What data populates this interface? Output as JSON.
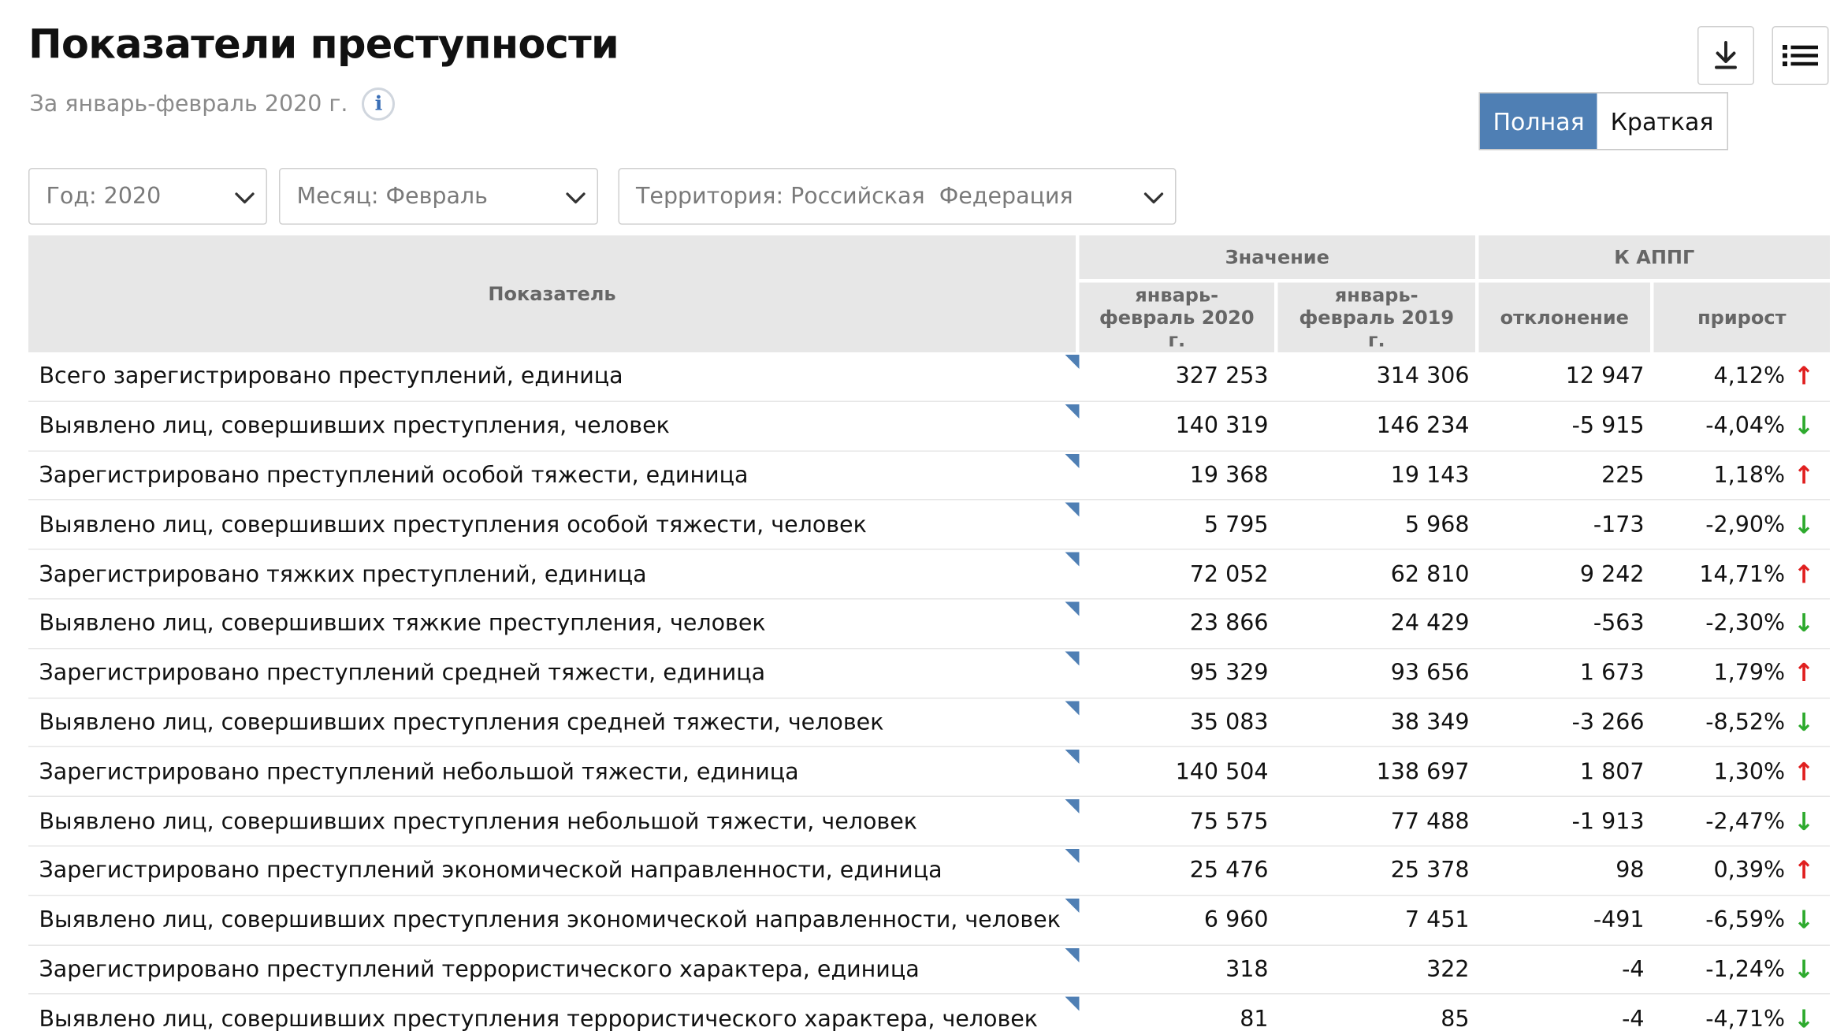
{
  "header": {
    "title": "Показатели преступности",
    "subtitle": "За январь-февраль 2020 г.",
    "info_icon": "info-icon"
  },
  "toolbar": {
    "download_icon": "download-icon",
    "menu_icon": "list-menu-icon"
  },
  "view_toggle": {
    "full_label": "Полная",
    "short_label": "Краткая",
    "active": "full"
  },
  "filters": {
    "year": "Год: 2020",
    "month": "Месяц: Февраль",
    "territory": "Территория: Российская  Федерация"
  },
  "table": {
    "col_indicator": "Показатель",
    "group_value": "Значение",
    "group_appg": "К АППГ",
    "col_2020": "январь-февраль 2020 г.",
    "col_2019": "январь-февраль 2019 г.",
    "col_deviation": "отклонение",
    "col_growth": "прирост",
    "accent_up": "#e02020",
    "accent_down": "#2eaa2e",
    "rows": [
      {
        "name": "Всего зарегистрировано преступлений, единица",
        "v2020": "327 253",
        "v2019": "314 306",
        "dev": "12 947",
        "growth": "4,12%",
        "dir": "up"
      },
      {
        "name": "Выявлено лиц, совершивших преступления, человек",
        "v2020": "140 319",
        "v2019": "146 234",
        "dev": "-5 915",
        "growth": "-4,04%",
        "dir": "down"
      },
      {
        "name": "Зарегистрировано преступлений особой тяжести, единица",
        "v2020": "19 368",
        "v2019": "19 143",
        "dev": "225",
        "growth": "1,18%",
        "dir": "up"
      },
      {
        "name": "Выявлено лиц, совершивших преступления особой тяжести, человек",
        "v2020": "5 795",
        "v2019": "5 968",
        "dev": "-173",
        "growth": "-2,90%",
        "dir": "down"
      },
      {
        "name": "Зарегистрировано тяжких преступлений, единица",
        "v2020": "72 052",
        "v2019": "62 810",
        "dev": "9 242",
        "growth": "14,71%",
        "dir": "up"
      },
      {
        "name": "Выявлено лиц, совершивших тяжкие преступления, человек",
        "v2020": "23 866",
        "v2019": "24 429",
        "dev": "-563",
        "growth": "-2,30%",
        "dir": "down"
      },
      {
        "name": "Зарегистрировано преступлений средней тяжести, единица",
        "v2020": "95 329",
        "v2019": "93 656",
        "dev": "1 673",
        "growth": "1,79%",
        "dir": "up"
      },
      {
        "name": "Выявлено лиц, совершивших преступления средней тяжести, человек",
        "v2020": "35 083",
        "v2019": "38 349",
        "dev": "-3 266",
        "growth": "-8,52%",
        "dir": "down"
      },
      {
        "name": "Зарегистрировано преступлений небольшой тяжести, единица",
        "v2020": "140 504",
        "v2019": "138 697",
        "dev": "1 807",
        "growth": "1,30%",
        "dir": "up"
      },
      {
        "name": "Выявлено лиц, совершивших преступления небольшой тяжести, человек",
        "v2020": "75 575",
        "v2019": "77 488",
        "dev": "-1 913",
        "growth": "-2,47%",
        "dir": "down"
      },
      {
        "name": "Зарегистрировано преступлений экономической направленности, единица",
        "v2020": "25 476",
        "v2019": "25 378",
        "dev": "98",
        "growth": "0,39%",
        "dir": "up"
      },
      {
        "name": "Выявлено лиц, совершивших преступления экономической направленности, человек",
        "v2020": "6 960",
        "v2019": "7 451",
        "dev": "-491",
        "growth": "-6,59%",
        "dir": "down"
      },
      {
        "name": "Зарегистрировано преступлений террористического характера, единица",
        "v2020": "318",
        "v2019": "322",
        "dev": "-4",
        "growth": "-1,24%",
        "dir": "down"
      },
      {
        "name": "Выявлено лиц, совершивших преступления террористического характера, человек",
        "v2020": "81",
        "v2019": "85",
        "dev": "-4",
        "growth": "-4,71%",
        "dir": "down"
      }
    ]
  }
}
